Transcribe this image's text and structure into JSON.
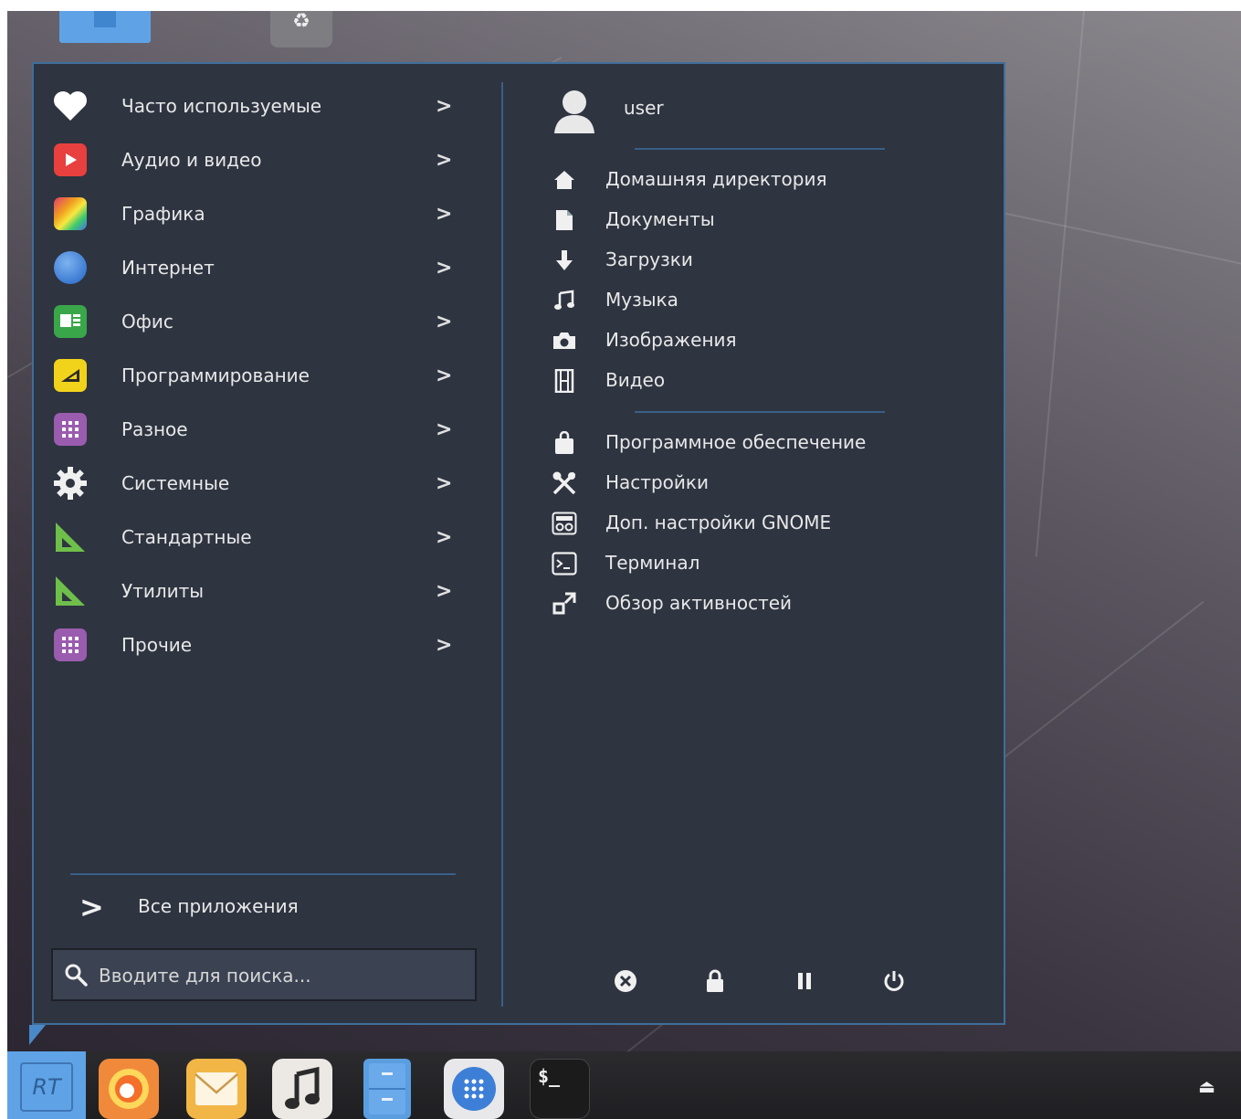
{
  "categories": [
    {
      "label": "Часто используемые",
      "icon": "heart-icon"
    },
    {
      "label": "Аудио и видео",
      "icon": "play-icon"
    },
    {
      "label": "Графика",
      "icon": "graphics-icon"
    },
    {
      "label": "Интернет",
      "icon": "globe-icon"
    },
    {
      "label": "Офис",
      "icon": "office-icon"
    },
    {
      "label": "Программирование",
      "icon": "programming-icon"
    },
    {
      "label": "Разное",
      "icon": "grid-icon"
    },
    {
      "label": "Системные",
      "icon": "gear-icon"
    },
    {
      "label": "Стандартные",
      "icon": "set-square-icon"
    },
    {
      "label": "Утилиты",
      "icon": "set-square-icon"
    },
    {
      "label": "Прочие",
      "icon": "grid-icon"
    }
  ],
  "all_apps_label": "Все приложения",
  "search": {
    "placeholder": "Вводите для поиска..."
  },
  "user": {
    "name": "user"
  },
  "places": [
    {
      "label": "Домашняя директория",
      "icon": "home-icon"
    },
    {
      "label": "Документы",
      "icon": "document-icon"
    },
    {
      "label": "Загрузки",
      "icon": "download-icon"
    },
    {
      "label": "Музыка",
      "icon": "music-icon"
    },
    {
      "label": "Изображения",
      "icon": "camera-icon"
    },
    {
      "label": "Видео",
      "icon": "film-icon"
    }
  ],
  "system": [
    {
      "label": "Программное обеспечение",
      "icon": "shopping-bag-icon"
    },
    {
      "label": "Настройки",
      "icon": "tools-icon"
    },
    {
      "label": "Доп. настройки GNOME",
      "icon": "tweaks-icon"
    },
    {
      "label": "Терминал",
      "icon": "terminal-icon"
    },
    {
      "label": "Обзор активностей",
      "icon": "activities-icon"
    }
  ],
  "session_icons": [
    "logout-icon",
    "lock-icon",
    "suspend-icon",
    "power-icon"
  ],
  "taskbar": {
    "terminal_glyph": "$_"
  },
  "colors": {
    "menu_bg": "#2e3440",
    "accent": "#3f6e9b",
    "launcher": "#5fa3e6"
  }
}
